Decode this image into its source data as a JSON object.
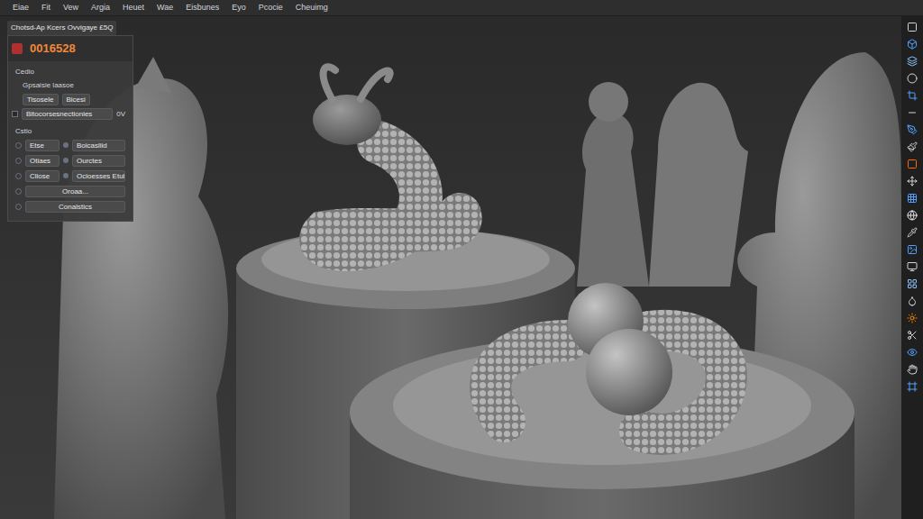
{
  "menu_bar": {
    "items": [
      "Eiae",
      "Fit",
      "Vew",
      "Argia",
      "Heuet",
      "Wae",
      "Eisbunes",
      "Eyo",
      "Pcocie",
      "Cheuimg"
    ]
  },
  "tool_panel": {
    "title": "Chotsd-Ap Kcers Ovvigaye £5Q",
    "counter": "0016528",
    "sections": [
      {
        "title": "Cedio",
        "rows": [
          {
            "kind": "text",
            "label": "Gpsaisie laasoe"
          },
          {
            "kind": "fields",
            "values": [
              "Tisosele",
              "Bicesi"
            ]
          },
          {
            "kind": "check",
            "label": "Bitocorsesnectionies",
            "value": "0V",
            "checked": false
          }
        ]
      },
      {
        "title": "Cstio",
        "rows": [
          {
            "kind": "pair",
            "label": "Etse",
            "value": "Boicasliid"
          },
          {
            "kind": "pair",
            "label": "Otiaes",
            "value": "Ourctes"
          },
          {
            "kind": "pair",
            "label": "Cliose",
            "value": "Ocioesses Etul"
          },
          {
            "kind": "field",
            "value": "Oroaa..."
          },
          {
            "kind": "field",
            "value": "Conalstics"
          }
        ]
      }
    ]
  }
}
